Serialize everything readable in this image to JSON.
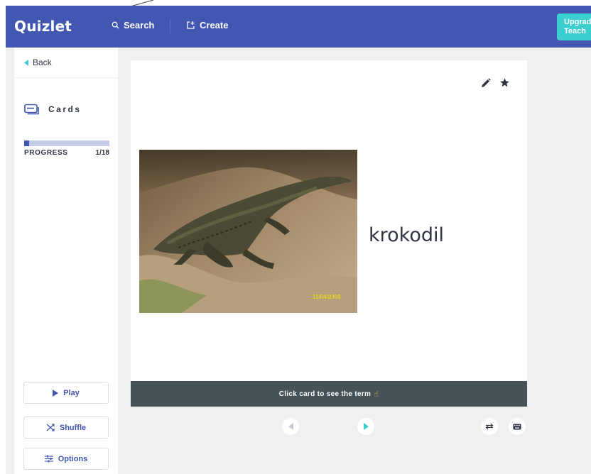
{
  "header": {
    "logo": "Quizlet",
    "search_label": "Search",
    "create_label": "Create",
    "upgrade_line1": "Upgrade",
    "upgrade_line2": "Teach"
  },
  "sidebar": {
    "back_label": "Back",
    "mode_label": "Cards",
    "progress_label": "PROGRESS",
    "progress_count": "1/18",
    "progress_fraction": 0.0556,
    "play_label": "Play",
    "shuffle_label": "Shuffle",
    "options_label": "Options"
  },
  "card": {
    "word": "krokodil",
    "image_stamp": "11/04/2008",
    "hint": "Click card to see the term",
    "hint_icon": "pointing-hand-icon"
  },
  "icons": {
    "edit": "pencil-icon",
    "star": "star-icon",
    "prev": "chevron-left-icon",
    "next": "chevron-right-icon",
    "swap": "swap-arrows-icon",
    "keyboard": "keyboard-icon"
  },
  "colors": {
    "brand": "#4257b2",
    "accent": "#3ccfcf",
    "hint_bar": "#455358",
    "background": "#f0f0f0"
  }
}
